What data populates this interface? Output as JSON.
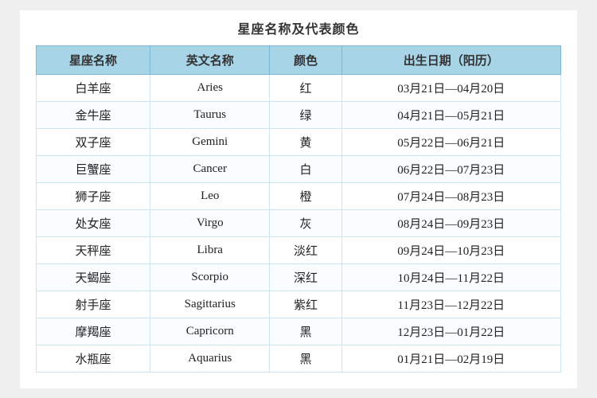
{
  "title": "星座名称及代表颜色",
  "table": {
    "headers": [
      "星座名称",
      "英文名称",
      "颜色",
      "出生日期（阳历）"
    ],
    "rows": [
      [
        "白羊座",
        "Aries",
        "红",
        "03月21日—04月20日"
      ],
      [
        "金牛座",
        "Taurus",
        "绿",
        "04月21日—05月21日"
      ],
      [
        "双子座",
        "Gemini",
        "黄",
        "05月22日—06月21日"
      ],
      [
        "巨蟹座",
        "Cancer",
        "白",
        "06月22日—07月23日"
      ],
      [
        "狮子座",
        "Leo",
        "橙",
        "07月24日—08月23日"
      ],
      [
        "处女座",
        "Virgo",
        "灰",
        "08月24日—09月23日"
      ],
      [
        "天秤座",
        "Libra",
        "淡红",
        "09月24日—10月23日"
      ],
      [
        "天蝎座",
        "Scorpio",
        "深红",
        "10月24日—11月22日"
      ],
      [
        "射手座",
        "Sagittarius",
        "紫红",
        "11月23日—12月22日"
      ],
      [
        "摩羯座",
        "Capricorn",
        "黑",
        "12月23日—01月22日"
      ],
      [
        "水瓶座",
        "Aquarius",
        "黑",
        "01月21日—02月19日"
      ]
    ]
  }
}
